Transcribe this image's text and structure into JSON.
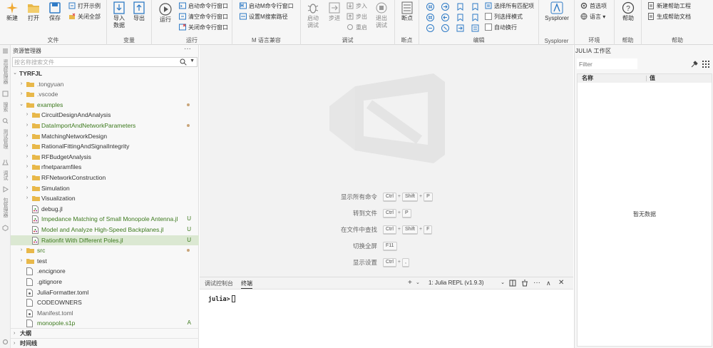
{
  "ribbon": {
    "groups": {
      "file": "文件",
      "variable": "变量",
      "run": "运行",
      "m_compat": "M 语言兼容",
      "debug": "调试",
      "breakpoint": "断点",
      "edit": "编辑",
      "sysplorer": "Sysplorer",
      "env": "环境",
      "help": "帮助",
      "help2": "帮助"
    },
    "buttons": {
      "new": "新建",
      "open": "打开",
      "save": "保存",
      "open_example": "打开示例",
      "close_all": "关闭全部",
      "import_data": "导入\n数据",
      "export": "导出",
      "run": "运行",
      "start_cmd": "启动命令行窗口",
      "clear_cmd": "清空命令行窗口",
      "close_cmd": "关闭命令行窗口",
      "start_m": "启动M命令行窗口",
      "set_m_path": "设置M搜索路径",
      "start_debug": "启动\n调试",
      "step_over": "步进",
      "step_in": "步入",
      "step_out": "步出",
      "restart": "重启",
      "exit_debug": "退出\n调试",
      "breakpoint": "断点",
      "select_all_match": "选择所有匹配项",
      "column_select": "列选择模式",
      "word_wrap": "自动换行",
      "sysplorer": "Sysplorer",
      "preferences": "首选项",
      "language": "语言",
      "help": "帮助",
      "new_help_project": "新建帮助工程",
      "gen_help_doc": "生成帮助文档"
    }
  },
  "activity": {
    "explorer": "资源管理器",
    "search": "搜索",
    "test_manager": "测试管理",
    "debug": "调试",
    "package_manager": "包管理器"
  },
  "explorer": {
    "title": "资源管理器",
    "more": "···",
    "search_placeholder": "按名称搜索文件",
    "root": "TYRFJL",
    "items": [
      {
        "label": ".tongyuan"
      },
      {
        "label": ".vscode"
      },
      {
        "label": "examples"
      },
      {
        "label": "CircuitDesignAndAnalysis"
      },
      {
        "label": "DataImportAndNetworkParameters"
      },
      {
        "label": "MatchingNetworkDesign"
      },
      {
        "label": "RationalFittingAndSignalIntegrity"
      },
      {
        "label": "RFBudgetAnalysis"
      },
      {
        "label": "rfnetparamfiles"
      },
      {
        "label": "RFNetworkConstruction"
      },
      {
        "label": "Simulation"
      },
      {
        "label": "Visualization"
      },
      {
        "label": "debug.jl"
      },
      {
        "label": "Impedance Matching of Small Monopole Antenna.jl",
        "badge": "U"
      },
      {
        "label": "Model and Analyze High-Speed Backplanes.jl",
        "badge": "U"
      },
      {
        "label": "Rationfit With Different Poles.jl",
        "badge": "U"
      },
      {
        "label": "src"
      },
      {
        "label": "test"
      },
      {
        "label": ".encignore"
      },
      {
        "label": ".gitignore"
      },
      {
        "label": "JuliaFormatter.toml"
      },
      {
        "label": "CODEOWNERS"
      },
      {
        "label": "Manifest.toml"
      },
      {
        "label": "monopole.s1p",
        "badge": "A"
      }
    ],
    "outline": "大纲",
    "timeline": "时间线"
  },
  "editor": {
    "shortcuts": [
      {
        "label": "显示所有命令",
        "keys": [
          "Ctrl",
          "Shift",
          "P"
        ]
      },
      {
        "label": "转到文件",
        "keys": [
          "Ctrl",
          "P"
        ]
      },
      {
        "label": "在文件中查找",
        "keys": [
          "Ctrl",
          "Shift",
          "F"
        ]
      },
      {
        "label": "切换全屏",
        "keys": [
          "F11"
        ]
      },
      {
        "label": "显示设置",
        "keys": [
          "Ctrl",
          ","
        ]
      }
    ]
  },
  "panel": {
    "tab_debug_console": "调试控制台",
    "tab_terminal": "终端",
    "repl_select": "1: Julia REPL (v1.9.3)",
    "prompt": "julia>"
  },
  "workspace": {
    "title": "JULIA 工作区",
    "filter_placeholder": "Filter",
    "col_name": "名称",
    "col_value": "值",
    "empty": "暂无数据"
  },
  "colors": {
    "accent_green": "#3d7a1e",
    "selection": "#dbe8d2",
    "folder": "#e8b84a",
    "blue_icon": "#2f7bc6"
  }
}
